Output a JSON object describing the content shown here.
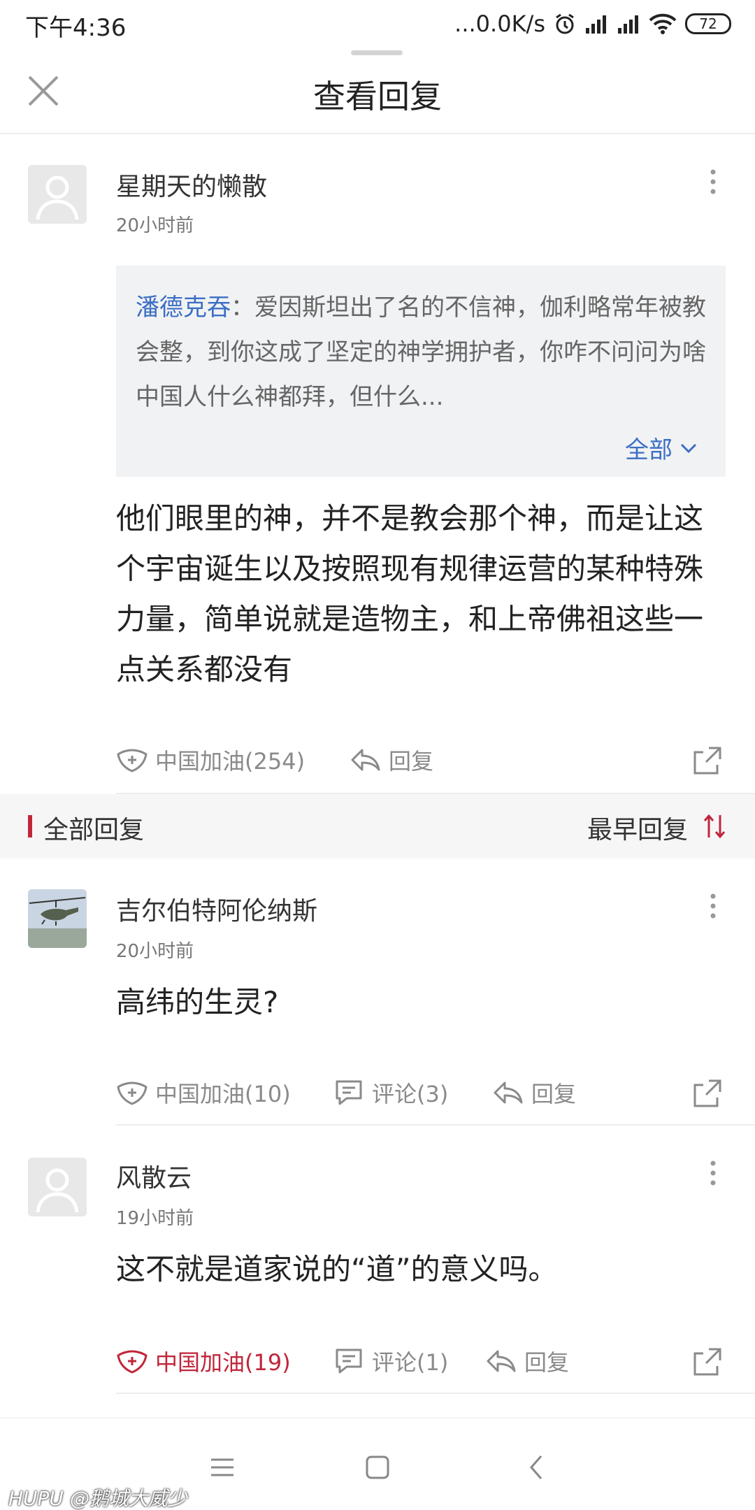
{
  "status_bar": {
    "time": "下午4:36",
    "network_speed": "...0.0K/s",
    "battery": "72"
  },
  "header": {
    "title": "查看回复"
  },
  "main_comment": {
    "username": "星期天的懒散",
    "time": "20小时前",
    "quote": {
      "author": "潘德克吞",
      "separator": "：",
      "text": "爱因斯坦出了名的不信神，伽利略常年被教会整，到你这成了坚定的神学拥护者，你咋不问问为啥中国人什么神都拜，但什么...",
      "expand_label": "全部"
    },
    "text": "他们眼里的神，并不是教会那个神，而是让这个宇宙诞生以及按照现有规律运营的某种特殊力量，简单说就是造物主，和上帝佛祖这些一点关系都没有",
    "like_label": "中国加油(254)",
    "reply_label": "回复"
  },
  "section": {
    "title": "全部回复",
    "sort_label": "最早回复"
  },
  "replies": [
    {
      "username": "吉尔伯特阿伦纳斯",
      "time": "20小时前",
      "text": "高纬的生灵?",
      "like_label": "中国加油(10)",
      "comment_label": "评论(3)",
      "reply_label": "回复",
      "liked": false
    },
    {
      "username": "风散云",
      "time": "19小时前",
      "text": "这不就是道家说的“道”的意义吗。",
      "like_label": "中国加油(19)",
      "comment_label": "评论(1)",
      "reply_label": "回复",
      "liked": true
    }
  ],
  "watermark": "HUPU @鹅城大威少",
  "colors": {
    "accent_red": "#c0263a",
    "link_blue": "#3b6fc4"
  }
}
